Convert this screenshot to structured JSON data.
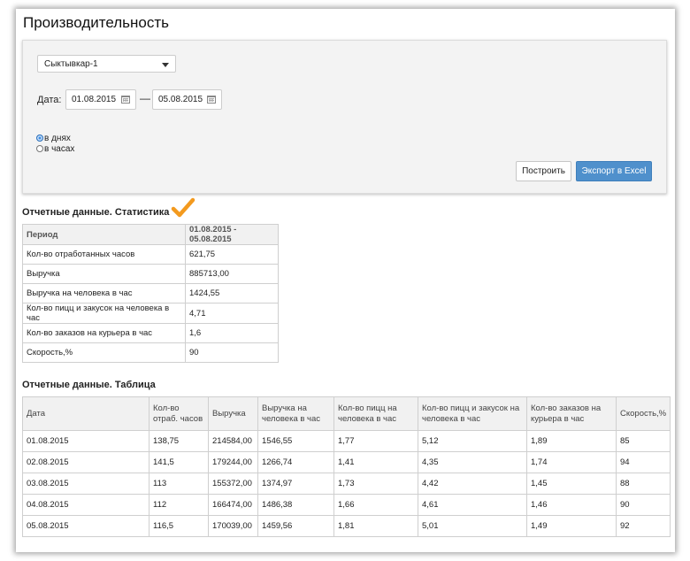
{
  "page": {
    "title": "Производительность"
  },
  "filters": {
    "city": "Сыктывкар-1",
    "date_label": "Дата:",
    "date_from": "01.08.2015",
    "date_sep": "—",
    "date_to": "05.08.2015",
    "mode_days": "в днях",
    "mode_hours": "в часах",
    "selected_mode": "days",
    "build_label": "Построить",
    "export_label": "Экспорт в Excel"
  },
  "stats": {
    "title": "Отчетные данные. Статистика",
    "header": [
      "Период",
      "01.08.2015 - 05.08.2015"
    ],
    "rows": [
      [
        "Кол-во отработанных часов",
        "621,75"
      ],
      [
        "Выручка",
        "885713,00"
      ],
      [
        "Выручка на человека в час",
        "1424,55"
      ],
      [
        "Кол-во пицц и закусок на человека в час",
        "4,71"
      ],
      [
        "Кол-во заказов на курьера в час",
        "1,6"
      ],
      [
        "Скорость,%",
        "90"
      ]
    ]
  },
  "report": {
    "title": "Отчетные данные. Таблица",
    "columns": [
      "Дата",
      "Кол-во отраб. часов",
      "Выручка",
      "Выручка на человека в час",
      "Кол-во пицц на человека в час",
      "Кол-во пицц и закусок на человека в час",
      "Кол-во заказов на курьера в час",
      "Скорость,%"
    ],
    "rows": [
      [
        "01.08.2015",
        "138,75",
        "214584,00",
        "1546,55",
        "1,77",
        "5,12",
        "1,89",
        "85"
      ],
      [
        "02.08.2015",
        "141,5",
        "179244,00",
        "1266,74",
        "1,41",
        "4,35",
        "1,74",
        "94"
      ],
      [
        "03.08.2015",
        "113",
        "155372,00",
        "1374,97",
        "1,73",
        "4,42",
        "1,45",
        "88"
      ],
      [
        "04.08.2015",
        "112",
        "166474,00",
        "1486,38",
        "1,66",
        "4,61",
        "1,46",
        "90"
      ],
      [
        "05.08.2015",
        "116,5",
        "170039,00",
        "1459,56",
        "1,81",
        "5,01",
        "1,49",
        "92"
      ]
    ]
  },
  "colors": {
    "accent": "#4f90cc",
    "checkmark": "#f39a1e",
    "radio_selected": "#3d8ee3"
  },
  "icons": {
    "checkmark": "checkmark-icon",
    "calendar": "calendar-icon",
    "dropdown": "chevron-down-icon"
  }
}
